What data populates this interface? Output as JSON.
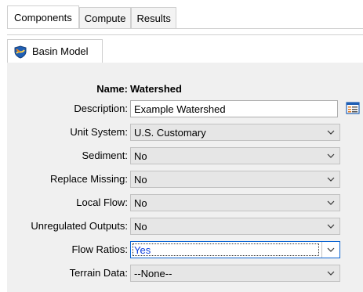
{
  "tabs": [
    {
      "label": "Components",
      "active": true
    },
    {
      "label": "Compute",
      "active": false
    },
    {
      "label": "Results",
      "active": false
    }
  ],
  "subtab": {
    "label": "Basin Model",
    "icon": "basin-model-icon"
  },
  "name": {
    "label": "Name:",
    "value": "Watershed"
  },
  "fields": [
    {
      "label": "Description:",
      "value": "Example Watershed",
      "kind": "text"
    },
    {
      "label": "Unit System:",
      "value": "U.S. Customary",
      "kind": "select"
    },
    {
      "label": "Sediment:",
      "value": "No",
      "kind": "select"
    },
    {
      "label": "Replace Missing:",
      "value": "No",
      "kind": "select"
    },
    {
      "label": "Local Flow:",
      "value": "No",
      "kind": "select"
    },
    {
      "label": "Unregulated Outputs:",
      "value": "No",
      "kind": "select"
    },
    {
      "label": "Flow Ratios:",
      "value": "Yes",
      "kind": "select",
      "focused": true
    },
    {
      "label": "Terrain Data:",
      "value": "--None--",
      "kind": "select"
    }
  ],
  "colors": {
    "panel_bg": "#f0f0f0",
    "focus_text": "#0a3cdc",
    "icon_orange": "#e07a1f",
    "icon_blue": "#1f5fb5"
  }
}
